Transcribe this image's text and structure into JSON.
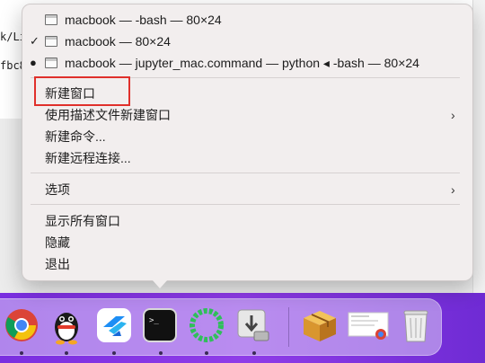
{
  "terminal_bg": {
    "line1": "k/Li",
    "line2": "fbc8"
  },
  "menu": {
    "windows": [
      {
        "label": "macbook — -bash — 80×24",
        "mark": ""
      },
      {
        "label": "macbook — 80×24",
        "mark": "✓"
      },
      {
        "label": "macbook — jupyter_mac.command — python ◂ -bash — 80×24",
        "mark": "●"
      }
    ],
    "new_window": "新建窗口",
    "new_window_with_profile": "使用描述文件新建窗口",
    "new_command": "新建命令...",
    "new_remote": "新建远程连接...",
    "options": "选项",
    "show_all_windows": "显示所有窗口",
    "hide": "隐藏",
    "quit": "退出",
    "submenu_chevron": "›"
  },
  "dock": {
    "apps": [
      "chrome-icon",
      "qq-icon",
      "feishu-icon",
      "terminal-icon",
      "loading-ring-icon",
      "installer-icon",
      "package-icon",
      "screenshot-thumbnail-icon",
      "trash-icon"
    ],
    "terminal_prompt": ">_"
  },
  "colors": {
    "menu_bg": "#f2eeee",
    "highlight_red": "#e0302b",
    "wallpaper": "#7a2ee0"
  }
}
